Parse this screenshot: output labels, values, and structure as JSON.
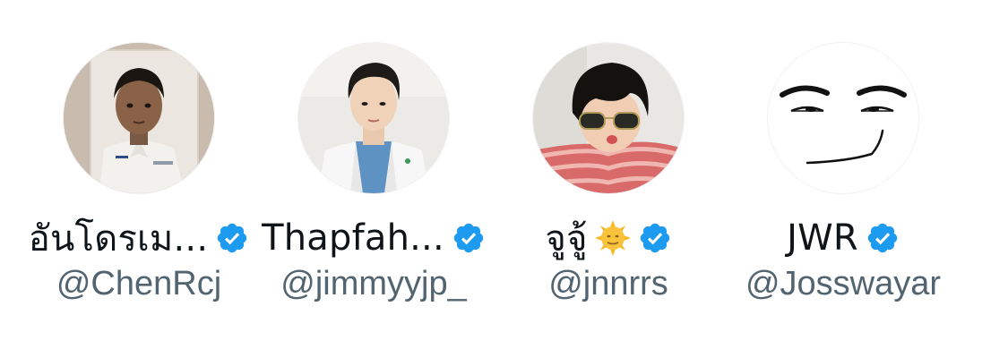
{
  "accounts": [
    {
      "display_name": "อันโดรเม...",
      "handle": "@ChenRcj",
      "verified": true,
      "avatar_icon": "student-photo-avatar"
    },
    {
      "display_name": "Thapfah...",
      "handle": "@jimmyyjp_",
      "verified": true,
      "avatar_icon": "doctor-coat-avatar"
    },
    {
      "display_name": "จูจู้",
      "handle": "@jnnrrs",
      "verified": true,
      "name_emoji": "sun-with-face-emoji",
      "avatar_icon": "sunglasses-selfie-avatar"
    },
    {
      "display_name": "JWR",
      "handle": "@Josswayar",
      "verified": true,
      "avatar_icon": "roblox-man-face-avatar"
    }
  ],
  "colors": {
    "name_text": "#0f1419",
    "handle_text": "#536471",
    "verified_badge": "#1d9bf0",
    "background": "#ffffff"
  }
}
